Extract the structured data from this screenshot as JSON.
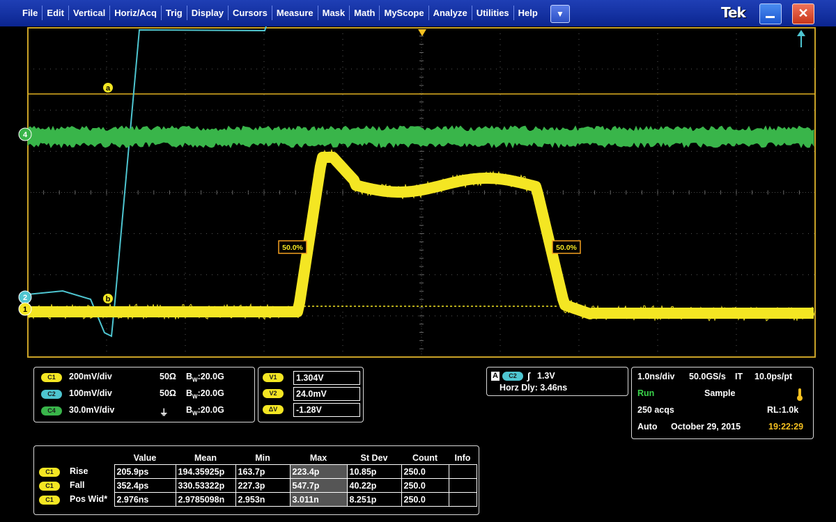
{
  "menu": [
    "File",
    "Edit",
    "Vertical",
    "Horiz/Acq",
    "Trig",
    "Display",
    "Cursors",
    "Measure",
    "Mask",
    "Math",
    "MyScope",
    "Analyze",
    "Utilities",
    "Help"
  ],
  "brand": "Tek",
  "icons": {
    "dropdown": "▼",
    "minimize": "minimize-icon",
    "close": "✕"
  },
  "scope": {
    "cursor_a": "a",
    "cursor_b": "b",
    "ch1_marker": "1",
    "ch2_marker": "2",
    "ch4_marker": "4",
    "ref_left": "50.0%",
    "ref_right": "50.0%"
  },
  "colors": {
    "ch1": "#f4e623",
    "ch2": "#4ec5d0",
    "ch4": "#39b54a",
    "graticule_border": "#c9a227"
  },
  "channels": [
    {
      "badge": "C1",
      "scale": "200mV/div",
      "imp": "50Ω",
      "bw": "B",
      "bwsub": "W",
      "bwval": ":20.0G"
    },
    {
      "badge": "C2",
      "scale": "100mV/div",
      "imp": "50Ω",
      "bw": "B",
      "bwsub": "W",
      "bwval": ":20.0G"
    },
    {
      "badge": "C4",
      "scale": "30.0mV/div",
      "imp": "⏚",
      "bw": "B",
      "bwsub": "W",
      "bwval": ":20.0G"
    }
  ],
  "cursors": [
    {
      "badge": "V1",
      "value": "1.304V"
    },
    {
      "badge": "V2",
      "value": "24.0mV"
    },
    {
      "badge": "ΔV",
      "value": "-1.28V"
    }
  ],
  "trigger": {
    "mode": "A",
    "source": "C2",
    "slope": "∫",
    "level": "1.3V",
    "delay": "Horz Dly:  3.46ns"
  },
  "acq": {
    "timebase": "1.0ns/div",
    "rate": "50.0GS/s",
    "mode": "IT",
    "resolution": "10.0ps/pt",
    "state": "Run",
    "acq_mode": "Sample",
    "acqs": "250 acqs",
    "rl": "RL:1.0k",
    "trig_mode": "Auto",
    "date": "October 29, 2015",
    "time": "19:22:29"
  },
  "measurements": {
    "headers": [
      "Value",
      "Mean",
      "Min",
      "Max",
      "St Dev",
      "Count",
      "Info"
    ],
    "rows": [
      {
        "badge": "C1",
        "name": "Rise",
        "value": "205.9ps",
        "mean": "194.35925p",
        "min": "163.7p",
        "max": "223.4p",
        "stdev": "10.85p",
        "count": "250.0",
        "info": ""
      },
      {
        "badge": "C1",
        "name": "Fall",
        "value": "352.4ps",
        "mean": "330.53322p",
        "min": "227.3p",
        "max": "547.7p",
        "stdev": "40.22p",
        "count": "250.0",
        "info": ""
      },
      {
        "badge": "C1",
        "name": "Pos Wid*",
        "value": "2.976ns",
        "mean": "2.9785098n",
        "min": "2.953n",
        "max": "3.011n",
        "stdev": "8.251p",
        "count": "250.0",
        "info": ""
      }
    ]
  }
}
